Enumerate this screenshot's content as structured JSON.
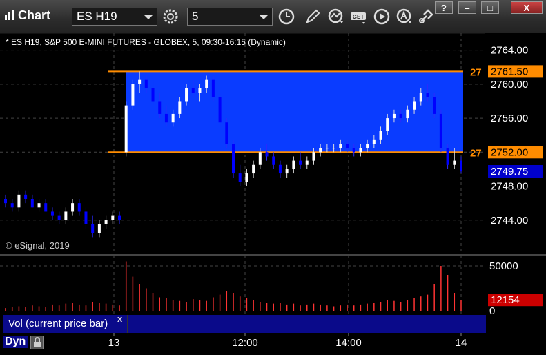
{
  "window": {
    "title": "Chart",
    "symbol": "ES H19",
    "interval": "5",
    "controls": {
      "help": "?",
      "minimize": "–",
      "maximize": "□",
      "close": "X"
    }
  },
  "toolbar": {
    "icons": [
      "settings-icon",
      "clock-icon",
      "pencil-icon",
      "study-icon",
      "get-icon",
      "play-icon",
      "alert-icon",
      "link-icon"
    ],
    "get_label": "GET"
  },
  "chart": {
    "info": "* ES H19, S&P 500 E-MINI FUTURES - GLOBEX, 5, 09:30-16:15 (Dynamic)",
    "copyright": "© eSignal, 2019",
    "price_ticks": [
      "2764.00",
      "2760.00",
      "2756.00",
      "2752.00",
      "2748.00",
      "2744.00"
    ],
    "level_upper": "2761.50",
    "level_lower": "2752.00",
    "level_upper_short": "27",
    "level_lower_short": "27",
    "last_price": "2749.75",
    "vol_ticks": [
      "50000",
      "0"
    ],
    "last_volume": "12154",
    "vol_legend": "Vol (current price bar)",
    "vol_close": "x",
    "time_ticks": [
      "13",
      "12:00",
      "14:00",
      "14"
    ],
    "dyn_label": "Dyn",
    "colors": {
      "up": "#ffffff",
      "down": "#0000ff",
      "zone": "#0a3cff",
      "level": "#ff8c00",
      "last": "#0000cc",
      "vol_last": "#cc0000"
    }
  },
  "chart_data": {
    "type": "candlestick",
    "title": "* ES H19, S&P 500 E-MINI FUTURES - GLOBEX, 5, 09:30-16:15 (Dynamic)",
    "ylim": [
      2740,
      2766
    ],
    "y_ticks": [
      2764,
      2760,
      2756,
      2752,
      2748,
      2744
    ],
    "x_ticks": [
      "13",
      "12:00",
      "14:00",
      "14"
    ],
    "levels": [
      2761.5,
      2752.0
    ],
    "last_price": 2749.75,
    "volume_ylim": [
      0,
      60000
    ],
    "volume_ticks": [
      50000,
      0
    ],
    "last_volume": 12154,
    "candles": [
      [
        2746.5,
        2747.0,
        2745.5,
        2746.0
      ],
      [
        2746.0,
        2746.5,
        2745.0,
        2745.5
      ],
      [
        2745.5,
        2747.5,
        2745.0,
        2747.0
      ],
      [
        2747.0,
        2747.5,
        2746.0,
        2746.5
      ],
      [
        2746.5,
        2747.0,
        2745.5,
        2745.5
      ],
      [
        2745.5,
        2746.5,
        2745.0,
        2746.0
      ],
      [
        2746.0,
        2746.5,
        2745.0,
        2745.0
      ],
      [
        2745.0,
        2745.5,
        2744.0,
        2744.5
      ],
      [
        2744.5,
        2745.0,
        2743.5,
        2744.0
      ],
      [
        2744.0,
        2745.5,
        2743.5,
        2745.0
      ],
      [
        2745.0,
        2746.5,
        2744.5,
        2746.0
      ],
      [
        2746.0,
        2746.5,
        2744.5,
        2745.0
      ],
      [
        2745.0,
        2745.5,
        2743.0,
        2743.5
      ],
      [
        2743.5,
        2744.5,
        2742.0,
        2742.5
      ],
      [
        2742.5,
        2744.0,
        2742.0,
        2743.5
      ],
      [
        2743.5,
        2744.5,
        2743.0,
        2744.0
      ],
      [
        2744.0,
        2745.0,
        2743.5,
        2744.5
      ],
      [
        2744.5,
        2745.0,
        2743.5,
        2744.0
      ],
      [
        2752.0,
        2758.0,
        2751.5,
        2757.5
      ],
      [
        2757.5,
        2760.5,
        2757.0,
        2760.0
      ],
      [
        2760.0,
        2761.5,
        2759.0,
        2760.5
      ],
      [
        2760.5,
        2761.0,
        2759.0,
        2759.5
      ],
      [
        2759.5,
        2760.5,
        2757.5,
        2758.0
      ],
      [
        2758.0,
        2759.0,
        2756.0,
        2756.5
      ],
      [
        2756.5,
        2757.5,
        2755.0,
        2755.5
      ],
      [
        2755.5,
        2757.0,
        2755.0,
        2756.5
      ],
      [
        2756.5,
        2758.5,
        2756.0,
        2758.0
      ],
      [
        2758.0,
        2760.0,
        2757.5,
        2759.5
      ],
      [
        2759.5,
        2760.5,
        2758.5,
        2759.0
      ],
      [
        2759.0,
        2760.0,
        2758.0,
        2759.5
      ],
      [
        2759.5,
        2761.0,
        2759.0,
        2760.5
      ],
      [
        2760.5,
        2761.0,
        2758.0,
        2758.5
      ],
      [
        2758.5,
        2759.0,
        2755.0,
        2755.5
      ],
      [
        2755.5,
        2756.0,
        2752.5,
        2753.0
      ],
      [
        2753.0,
        2753.5,
        2749.0,
        2749.5
      ],
      [
        2749.5,
        2750.5,
        2748.0,
        2748.5
      ],
      [
        2748.5,
        2750.0,
        2748.0,
        2749.5
      ],
      [
        2749.5,
        2751.0,
        2749.0,
        2750.5
      ],
      [
        2750.5,
        2752.5,
        2750.0,
        2752.0
      ],
      [
        2752.0,
        2753.0,
        2751.0,
        2751.5
      ],
      [
        2751.5,
        2752.0,
        2750.0,
        2750.5
      ],
      [
        2750.5,
        2751.0,
        2749.0,
        2749.5
      ],
      [
        2749.5,
        2750.5,
        2749.0,
        2750.0
      ],
      [
        2750.0,
        2751.5,
        2749.5,
        2751.0
      ],
      [
        2751.0,
        2752.0,
        2750.0,
        2750.5
      ],
      [
        2750.5,
        2751.5,
        2750.0,
        2751.0
      ],
      [
        2751.0,
        2752.5,
        2750.5,
        2752.0
      ],
      [
        2752.0,
        2753.0,
        2751.5,
        2752.5
      ],
      [
        2752.5,
        2753.0,
        2752.0,
        2752.5
      ],
      [
        2752.5,
        2753.0,
        2752.0,
        2752.5
      ],
      [
        2752.5,
        2753.5,
        2752.0,
        2753.0
      ],
      [
        2753.0,
        2753.5,
        2752.0,
        2752.5
      ],
      [
        2752.5,
        2753.0,
        2751.5,
        2752.0
      ],
      [
        2752.0,
        2753.0,
        2751.5,
        2752.5
      ],
      [
        2752.5,
        2753.5,
        2752.0,
        2753.0
      ],
      [
        2753.0,
        2754.0,
        2752.5,
        2753.5
      ],
      [
        2753.5,
        2755.0,
        2753.0,
        2754.5
      ],
      [
        2754.5,
        2756.5,
        2754.0,
        2756.0
      ],
      [
        2756.0,
        2757.0,
        2755.5,
        2756.5
      ],
      [
        2756.5,
        2757.0,
        2755.5,
        2756.0
      ],
      [
        2756.0,
        2757.5,
        2755.5,
        2757.0
      ],
      [
        2757.0,
        2758.5,
        2756.5,
        2758.0
      ],
      [
        2758.0,
        2759.5,
        2757.5,
        2759.0
      ],
      [
        2759.0,
        2760.0,
        2758.0,
        2758.5
      ],
      [
        2758.5,
        2759.0,
        2756.0,
        2756.5
      ],
      [
        2756.5,
        2757.0,
        2752.0,
        2752.5
      ],
      [
        2752.5,
        2753.0,
        2750.0,
        2750.5
      ],
      [
        2750.5,
        2752.5,
        2750.0,
        2751.0
      ],
      [
        2751.0,
        2751.5,
        2749.5,
        2749.75
      ]
    ],
    "volume": [
      3000,
      4000,
      5000,
      4000,
      6000,
      5000,
      4000,
      7000,
      6000,
      8000,
      9000,
      7000,
      6000,
      10000,
      9000,
      8000,
      7000,
      6000,
      55000,
      38000,
      30000,
      25000,
      20000,
      15000,
      14000,
      12000,
      11000,
      10000,
      13000,
      12000,
      11000,
      15000,
      18000,
      22000,
      20000,
      16000,
      14000,
      12000,
      10000,
      9000,
      8000,
      9000,
      7000,
      8000,
      6000,
      7000,
      8000,
      7000,
      6000,
      5000,
      6000,
      7000,
      6000,
      7000,
      8000,
      9000,
      10000,
      12000,
      11000,
      10000,
      12000,
      14000,
      16000,
      18000,
      30000,
      50000,
      40000,
      20000,
      12154
    ]
  }
}
